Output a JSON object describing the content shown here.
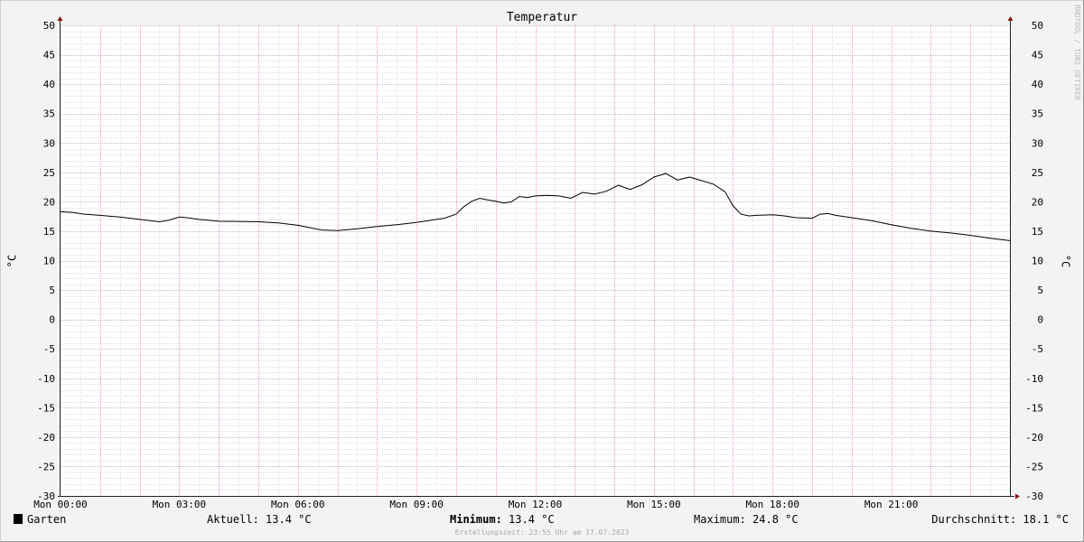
{
  "chart_data": {
    "type": "line",
    "title": "Temperatur",
    "ylabel": "°C",
    "ylim": [
      -30,
      50
    ],
    "xlim": [
      0,
      24
    ],
    "grid": true,
    "y_ticks": [
      50,
      45,
      40,
      35,
      30,
      25,
      20,
      15,
      10,
      5,
      0,
      -5,
      -10,
      -15,
      -20,
      -25,
      -30
    ],
    "x_ticks": [
      {
        "label": "Mon 00:00",
        "hour": 0
      },
      {
        "label": "Mon 03:00",
        "hour": 3
      },
      {
        "label": "Mon 06:00",
        "hour": 6
      },
      {
        "label": "Mon 09:00",
        "hour": 9
      },
      {
        "label": "Mon 12:00",
        "hour": 12
      },
      {
        "label": "Mon 15:00",
        "hour": 15
      },
      {
        "label": "Mon 18:00",
        "hour": 18
      },
      {
        "label": "Mon 21:00",
        "hour": 21
      }
    ],
    "watermark": "RRDTOOL / TOBI OETIKER",
    "series": [
      {
        "name": "Garten",
        "color": "#000000",
        "x": [
          0,
          0.3,
          0.6,
          1.0,
          1.5,
          2.0,
          2.5,
          2.75,
          3.0,
          3.2,
          3.5,
          4.0,
          5.0,
          5.5,
          6.0,
          6.3,
          6.6,
          7.0,
          7.5,
          8.0,
          8.5,
          9.0,
          9.5,
          9.7,
          10.0,
          10.2,
          10.4,
          10.6,
          10.8,
          11.0,
          11.2,
          11.4,
          11.6,
          11.8,
          12.0,
          12.3,
          12.6,
          12.9,
          13.2,
          13.5,
          13.8,
          14.1,
          14.4,
          14.7,
          15.0,
          15.3,
          15.6,
          15.9,
          16.2,
          16.5,
          16.8,
          17.0,
          17.2,
          17.4,
          17.6,
          18.0,
          18.3,
          18.6,
          19.0,
          19.2,
          19.4,
          19.6,
          20.0,
          20.5,
          21.0,
          21.5,
          22.0,
          22.5,
          23.0,
          23.5,
          24.0
        ],
        "y": [
          18.3,
          18.2,
          17.9,
          17.7,
          17.4,
          17.0,
          16.6,
          16.9,
          17.4,
          17.3,
          17.0,
          16.7,
          16.6,
          16.4,
          16.0,
          15.6,
          15.2,
          15.1,
          15.4,
          15.8,
          16.1,
          16.5,
          17.0,
          17.2,
          17.9,
          19.2,
          20.1,
          20.6,
          20.3,
          20.1,
          19.8,
          20.0,
          20.9,
          20.7,
          21.0,
          21.1,
          21.0,
          20.6,
          21.6,
          21.3,
          21.8,
          22.8,
          22.1,
          22.9,
          24.2,
          24.8,
          23.7,
          24.2,
          23.6,
          23.0,
          21.7,
          19.3,
          17.9,
          17.6,
          17.7,
          17.8,
          17.6,
          17.3,
          17.2,
          17.9,
          18.0,
          17.7,
          17.3,
          16.8,
          16.1,
          15.5,
          15.0,
          14.7,
          14.3,
          13.8,
          13.4
        ]
      }
    ]
  },
  "legend": {
    "series_name": "Garten",
    "aktuell": "Aktuell: 13.4 °C",
    "minimum_label": "Minimum:",
    "minimum_value": " 13.4 °C",
    "maximum": "Maximum: 24.8 °C",
    "durchschnitt": "Durchschnitt: 18.1 °C",
    "erstellungszeit": "Erstellungszeit: 23:55 Uhr am 17.07.2023"
  }
}
